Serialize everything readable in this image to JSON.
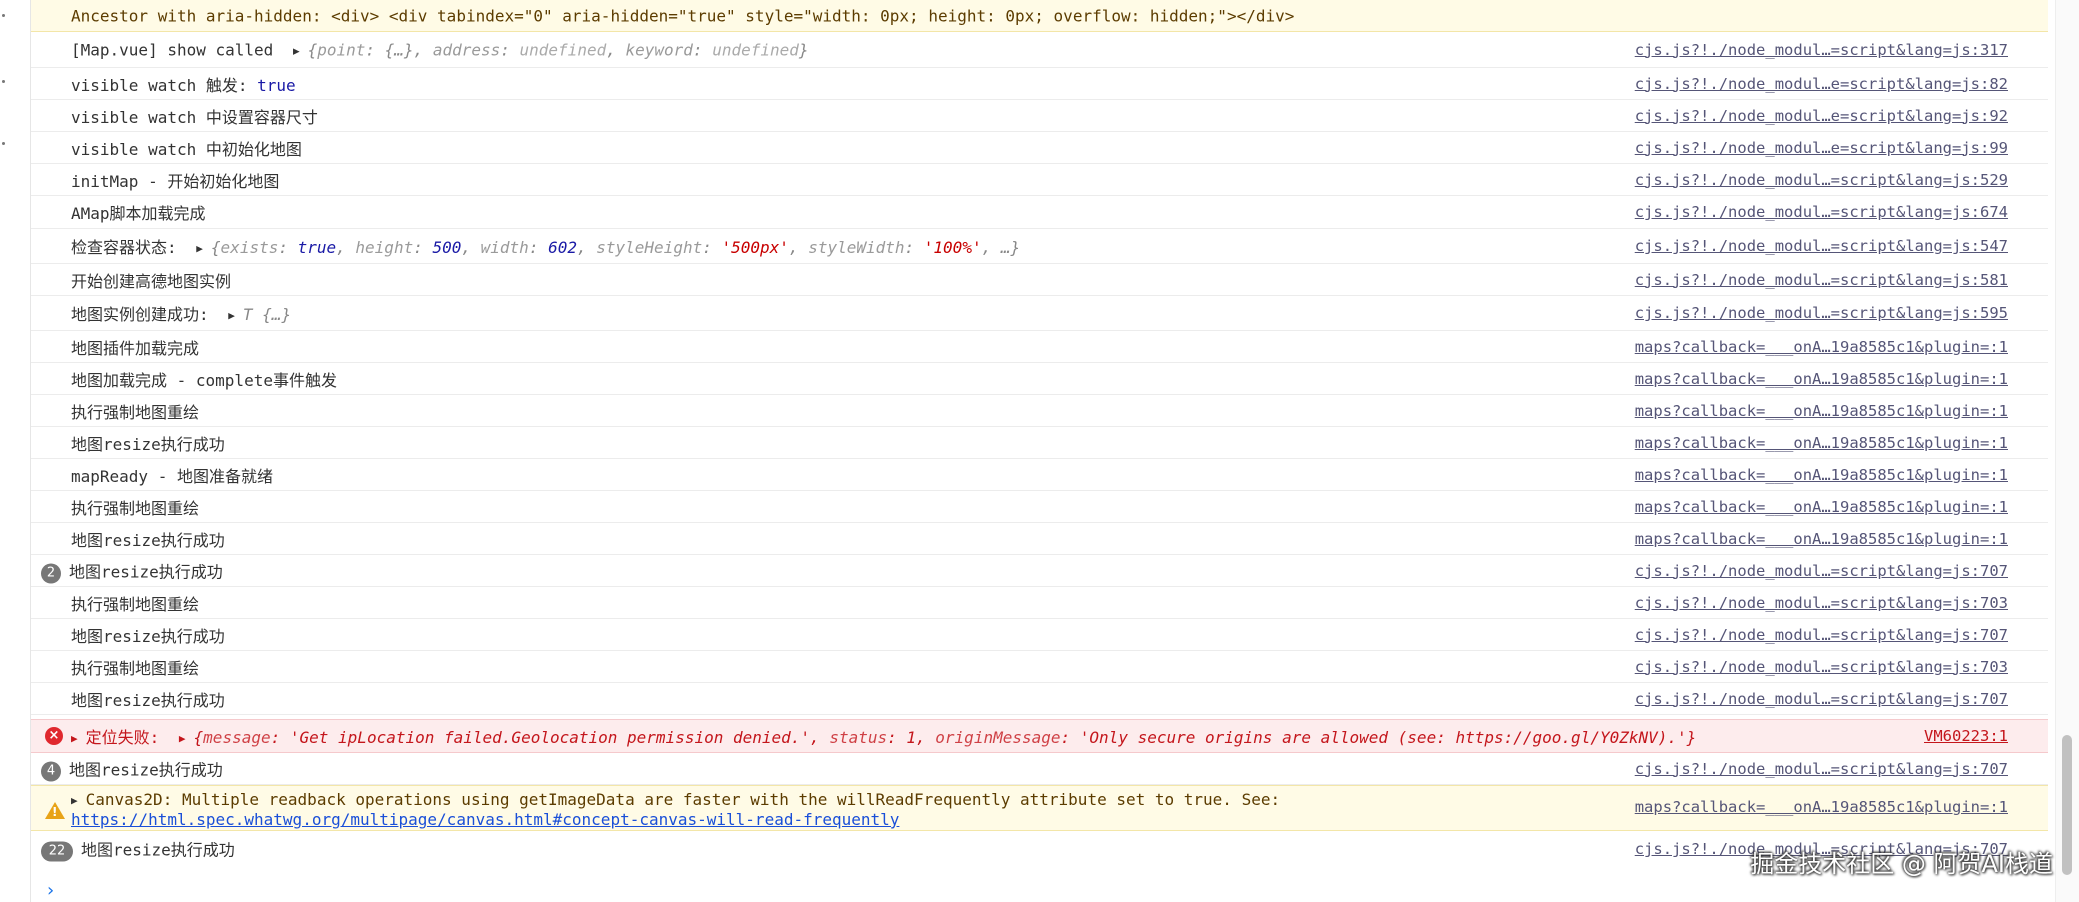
{
  "warning_bar": {
    "text": "Ancestor with aria-hidden: <div>    <div tabindex=\"0\" aria-hidden=\"true\" style=\"width: 0px; height: 0px; overflow: hidden;\"></div>"
  },
  "show_row": {
    "label": "[Map.vue] show called",
    "obj_open": "{",
    "k1": "point",
    "v1": "{…}",
    "k2": "address",
    "v2": "undefined",
    "k3": "keyword",
    "v3": "undefined",
    "obj_close": "}",
    "source": "cjs.js?!./node_modul…=script&lang=js:317"
  },
  "rows": [
    {
      "text": "visible watch 触发: ",
      "kw": "true",
      "source": "cjs.js?!./node_modul…e=script&lang=js:82"
    },
    {
      "text": "visible watch 中设置容器尺寸",
      "kw": "",
      "source": "cjs.js?!./node_modul…e=script&lang=js:92"
    },
    {
      "text": "visible watch 中初始化地图",
      "kw": "",
      "source": "cjs.js?!./node_modul…e=script&lang=js:99"
    },
    {
      "text": "initMap - 开始初始化地图",
      "kw": "",
      "source": "cjs.js?!./node_modul…=script&lang=js:529"
    },
    {
      "text": "AMap脚本加载完成",
      "kw": "",
      "source": "cjs.js?!./node_modul…=script&lang=js:674"
    }
  ],
  "container_row": {
    "label": "检查容器状态: ",
    "k1": "exists",
    "v1": "true",
    "k2": "height",
    "v2": "500",
    "k3": "width",
    "v3": "602",
    "k4": "styleHeight",
    "v4": "'500px'",
    "k5": "styleWidth",
    "v5": "'100%'",
    "more": "…}",
    "source": "cjs.js?!./node_modul…=script&lang=js:547"
  },
  "create_row": {
    "text": "开始创建高德地图实例",
    "source": "cjs.js?!./node_modul…=script&lang=js:581"
  },
  "instance_row": {
    "label": "地图实例创建成功: ",
    "obj": "T  {…}",
    "source": "cjs.js?!./node_modul…=script&lang=js:595"
  },
  "rows2": [
    {
      "text": "地图插件加载完成",
      "source": "maps?callback=___onA…19a8585c1&plugin=:1"
    },
    {
      "text": "地图加载完成 - complete事件触发",
      "source": "maps?callback=___onA…19a8585c1&plugin=:1"
    },
    {
      "text": "执行强制地图重绘",
      "source": "maps?callback=___onA…19a8585c1&plugin=:1"
    },
    {
      "text": "地图resize执行成功",
      "source": "maps?callback=___onA…19a8585c1&plugin=:1"
    },
    {
      "text": "mapReady - 地图准备就绪",
      "source": "maps?callback=___onA…19a8585c1&plugin=:1"
    },
    {
      "text": "执行强制地图重绘",
      "source": "maps?callback=___onA…19a8585c1&plugin=:1"
    },
    {
      "text": "地图resize执行成功",
      "source": "maps?callback=___onA…19a8585c1&plugin=:1"
    }
  ],
  "count_row_1": {
    "count": "2",
    "text": "地图resize执行成功",
    "source": "cjs.js?!./node_modul…=script&lang=js:707"
  },
  "rows3": [
    {
      "text": "执行强制地图重绘",
      "source": "cjs.js?!./node_modul…=script&lang=js:703"
    },
    {
      "text": "地图resize执行成功",
      "source": "cjs.js?!./node_modul…=script&lang=js:707"
    },
    {
      "text": "执行强制地图重绘",
      "source": "cjs.js?!./node_modul…=script&lang=js:703"
    },
    {
      "text": "地图resize执行成功",
      "source": "cjs.js?!./node_modul…=script&lang=js:707"
    }
  ],
  "error_row": {
    "label": "定位失败: ",
    "k1": "message",
    "v1": "'Get ipLocation failed.Geolocation permission denied.'",
    "k2": "status",
    "v2": "1",
    "k3": "originMessage",
    "v3": "'Only secure origins are allowed (see: https://goo.gl/Y0ZkNV).'",
    "source": "VM60223:1"
  },
  "count_row_2": {
    "count": "4",
    "text": "地图resize执行成功",
    "source": "cjs.js?!./node_modul…=script&lang=js:707"
  },
  "warn_row": {
    "text": "Canvas2D: Multiple readback operations using getImageData are faster with the willReadFrequently attribute set to true. See:",
    "link": "https://html.spec.whatwg.org/multipage/canvas.html#concept-canvas-will-read-frequently",
    "source": "maps?callback=___onA…19a8585c1&plugin=:1"
  },
  "count_row_3": {
    "count": "22",
    "text": "地图resize执行成功",
    "source": "cjs.js?!./node_modul…=script&lang=js:707"
  },
  "prompt": "›",
  "watermark": "掘金技术社区 @ 阿贺AI栈道"
}
